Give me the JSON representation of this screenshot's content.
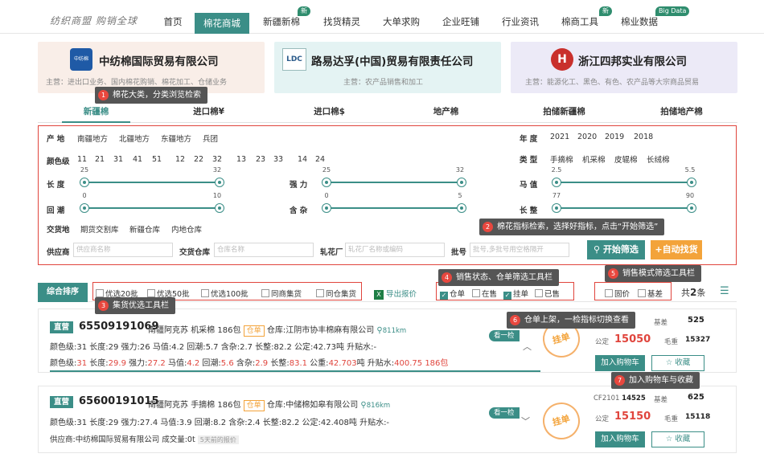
{
  "nav": {
    "logo": "纺织商盟  购销全球",
    "items": [
      "首页",
      "棉花商城",
      "新疆新棉",
      "找货精灵",
      "大单求购",
      "企业旺铺",
      "行业资讯",
      "棉商工具",
      "棉业数据"
    ],
    "badges": {
      "xinjiang": "新",
      "tools": "新",
      "data": "Big Data"
    }
  },
  "companies": [
    {
      "name": "中纺棉国际贸易有限公司",
      "desc": "主营：进出口业务、国内棉花购销、棉花加工、仓储业务",
      "logo_text": "中纺棉"
    },
    {
      "name": "路易达孚(中国)贸易有限责任公司",
      "desc": "主营：农产品销售和加工",
      "logo_text": "LDC"
    },
    {
      "name": "浙江四邦实业有限公司",
      "desc": "主营：能源化工、黑色、有色、农产品等大宗商品贸易",
      "logo_text": "H"
    }
  ],
  "tabs": [
    "新疆棉",
    "进口棉¥",
    "进口棉$",
    "地产棉",
    "拍储新疆棉",
    "拍储地产棉"
  ],
  "filters": {
    "origin_label": "产  地",
    "origins": [
      "南疆地方",
      "北疆地方",
      "东疆地方",
      "兵团"
    ],
    "year_label": "年  度",
    "years": [
      "2021",
      "2020",
      "2019",
      "2018"
    ],
    "grade_label": "颜色级",
    "grades": [
      "11",
      "21",
      "31",
      "41",
      "51",
      "12",
      "22",
      "32",
      "13",
      "23",
      "33",
      "14",
      "24"
    ],
    "type_label": "类  型",
    "types": [
      "手摘棉",
      "机采棉",
      "皮辊棉",
      "长绒棉"
    ],
    "length_label": "长  度",
    "length_min": "25",
    "length_max": "32",
    "strength_label": "强  力",
    "strength_min": "25",
    "strength_max": "32",
    "mic_label": "马  值",
    "mic_min": "2.5",
    "mic_max": "5.5",
    "rebound_label": "回  潮",
    "rebound_min": "0",
    "rebound_max": "10",
    "trash_label": "含  杂",
    "trash_min": "0",
    "trash_max": "5",
    "uniform_label": "长  整",
    "uniform_min": "77",
    "uniform_max": "90",
    "delivery_label": "交货地",
    "deliveries": [
      "期货交割库",
      "新疆仓库",
      "内地仓库"
    ],
    "supplier_label": "供应商",
    "supplier_ph": "供应商名称",
    "warehouse_label": "交货仓库",
    "warehouse_ph": "仓库名称",
    "gin_label": "轧花厂",
    "gin_ph": "轧花厂名称或编码",
    "batch_label": "批号",
    "batch_ph": "批号,多批号用空格隔开",
    "start_btn": "开始筛选",
    "auto_btn": "+自动找货"
  },
  "tips": [
    {
      "n": "1",
      "text": "棉花大类，分类浏览检索"
    },
    {
      "n": "2",
      "text": "棉花指标检索，选择好指标，点击“开始筛选”"
    },
    {
      "n": "3",
      "text": "集货优选工具栏"
    },
    {
      "n": "4",
      "text": "销售状态、仓单筛选工具栏"
    },
    {
      "n": "5",
      "text": "销售模式筛选工具栏"
    },
    {
      "n": "6",
      "text": "仓单上架，一检指标切换查看"
    },
    {
      "n": "7",
      "text": "加入购物车与收藏"
    }
  ],
  "toolbar": {
    "sort": "综合排序",
    "picks": [
      "优选20批",
      "优选50批",
      "优选100批",
      "同商集货",
      "同仓集货"
    ],
    "export": "导出报价",
    "status": [
      {
        "l": "仓单",
        "on": true
      },
      {
        "l": "在售",
        "on": false
      },
      {
        "l": "挂单",
        "on": true
      },
      {
        "l": "已售",
        "on": false
      }
    ],
    "modes": [
      "固价",
      "基差"
    ],
    "count_prefix": "共",
    "count": "2",
    "count_suffix": "条"
  },
  "listings": [
    {
      "tag": "直营",
      "id": "65509191069",
      "origin": "南疆阿克苏",
      "pick": "机采棉",
      "bales": "186包",
      "cd": "仓单",
      "wh": "仓库:江阴市协丰棉麻有限公司",
      "dist": "811km",
      "line2": "颜色级:31  长度:29  强力:26  马值:4.2  回潮:5.7  含杂:2.7  长整:82.2  公定:42.73吨  升贴水:-",
      "line3": [
        "颜色级:",
        "31",
        "  长度:",
        "29.9",
        "  强力:",
        "27.2",
        "  马值:",
        "4.2",
        "  回潮:",
        "5.6",
        "  含杂:",
        "2.9",
        "  长整:",
        "83.1",
        "  公重:",
        "42.703",
        "吨  升贴水:",
        "400.75",
        "  ",
        "186包"
      ],
      "flag": "看一检",
      "stamp": "挂单",
      "basis_label": "基差",
      "basis": "525",
      "price_label": "公定",
      "price": "15050",
      "gross_label": "毛重",
      "gross": "15327",
      "cart": "加入购物车",
      "fav": "收藏"
    },
    {
      "tag": "直营",
      "id": "65600191015",
      "origin": "南疆阿克苏",
      "pick": "手摘棉",
      "bales": "186包",
      "cd": "仓单",
      "wh": "仓库:中储棉如皋有限公司",
      "dist": "816km",
      "line2": "颜色级:31  长度:29  强力:27.4  马值:3.9  回潮:8.2  含杂:2.4  长整:82.2  公定:42.408吨  升贴水:-",
      "supplier": "供应商:中纺棉国际贸易有限公司",
      "deal": "成交量:0t",
      "ago": "5天前的报价",
      "flag": "看一检",
      "stamp": "挂单",
      "contract": "CF2101",
      "contract_val": "14525",
      "basis_label": "基差",
      "basis": "625",
      "price_label": "公定",
      "price": "15150",
      "gross_label": "毛重",
      "gross": "15118",
      "cart": "加入购物车",
      "fav": "收藏"
    }
  ],
  "colors": {
    "accent": "#3b8e87",
    "red": "#e0453d",
    "orange": "#f3a33a"
  }
}
